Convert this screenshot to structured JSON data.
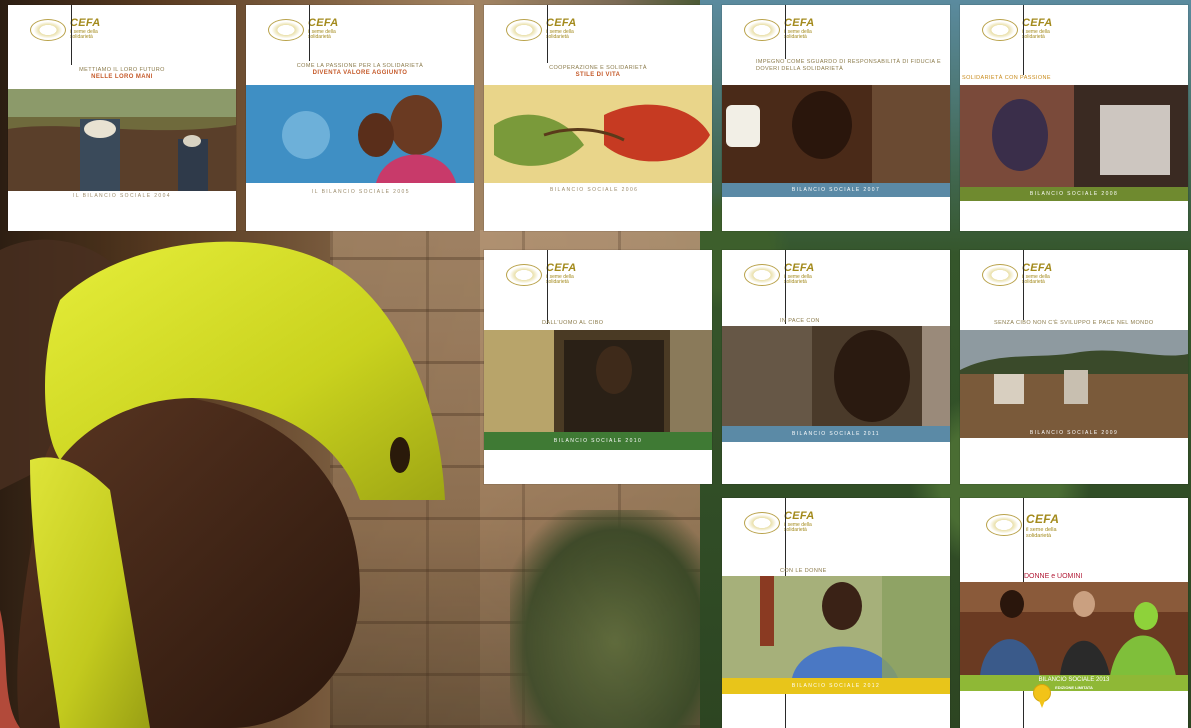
{
  "brand": {
    "name": "CEFA",
    "subline": "il seme della solidarietà",
    "accent": "#a38a1c"
  },
  "cards": [
    {
      "id": "2004",
      "tagline_top": "mettiamo il loro futuro",
      "tagline_main": "nelle loro mani",
      "band": "",
      "foot": "il bilancio sociale 2004",
      "band_color": "#ffffff"
    },
    {
      "id": "2005",
      "tagline_top": "come la passione per la solidarietà",
      "tagline_main": "diventa valore aggiunto",
      "band": "",
      "foot": "il bilancio sociale 2005",
      "band_color": "#ffffff"
    },
    {
      "id": "2006",
      "tagline_top": "cooperazione e solidarietà",
      "tagline_main": "stile di vita",
      "band": "",
      "foot": "bilancio sociale 2006",
      "band_color": "#ffffff"
    },
    {
      "id": "2007",
      "tagline_top": "impegno come sguardo di responsabilità di fiducia e doveri della solidarietà",
      "tagline_main": "",
      "band": "bilancio sociale 2007",
      "foot": "",
      "band_color": "#5b8aa6"
    },
    {
      "id": "2008",
      "tagline_top": "solidarietà con passione",
      "tagline_main": "",
      "band": "bilancio sociale 2008",
      "foot": "",
      "band_color": "#6f8a2f"
    },
    {
      "id": "2010",
      "tagline_top": "dall'uomo al cibo",
      "tagline_main": "",
      "band": "bilancio sociale 2010",
      "foot": "",
      "band_color": "#3f7a34"
    },
    {
      "id": "2011",
      "tagline_top": "in pace con",
      "tagline_main": "",
      "band": "bilancio sociale 2011",
      "foot": "",
      "band_color": "#5b8aa6"
    },
    {
      "id": "2009",
      "tagline_top": "senza cibo non c'è sviluppo e pace nel mondo",
      "tagline_main": "",
      "band": "bilancio sociale 2009",
      "foot": "",
      "band_color": "#7a6a4a"
    },
    {
      "id": "2012",
      "tagline_top": "con le donne",
      "tagline_main": "",
      "band": "bilancio sociale 2012",
      "foot": "",
      "band_color": "#e8c51a"
    }
  ],
  "card_2013": {
    "title": "DONNE e UOMINI",
    "band_line1": "BILANCIO SOCIALE 2013",
    "band_line2": "EDIZIONE LIMITATA"
  }
}
